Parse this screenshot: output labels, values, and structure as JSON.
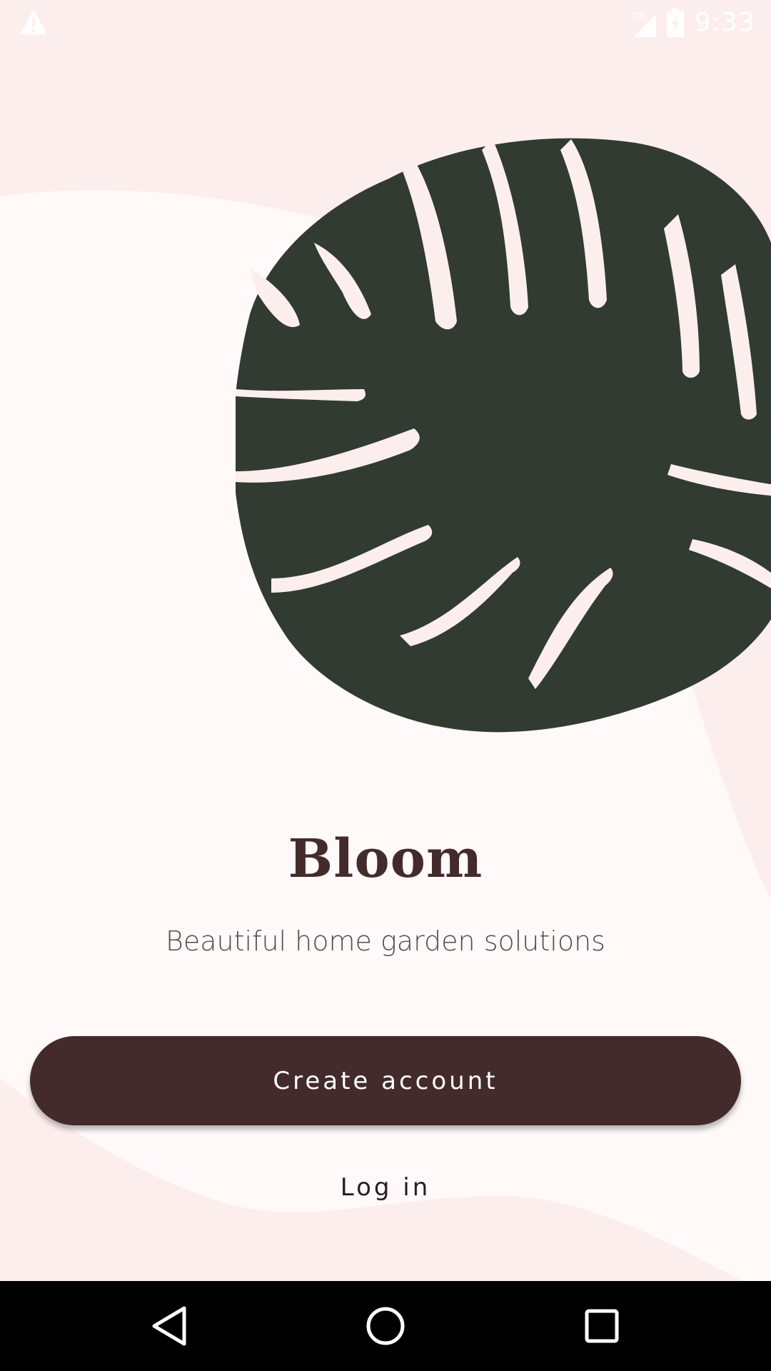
{
  "app": {
    "title": "Bloom",
    "tagline": "Beautiful home garden solutions"
  },
  "actions": {
    "create_account_label": "Create account",
    "login_label": "Log in"
  },
  "status_bar": {
    "time": "9:33",
    "network": "LTE",
    "alert_icon": "warning-icon",
    "signal_icon": "signal-icon",
    "battery_icon": "battery-charging-icon"
  },
  "navigation": {
    "back_icon": "back-triangle-icon",
    "home_icon": "home-circle-icon",
    "recents_icon": "recents-square-icon"
  },
  "illustration": {
    "name": "monstera-leaf"
  },
  "colors": {
    "background": "#fdeeee",
    "surface": "#fff9f9",
    "leaf": "#313b31",
    "primary": "#432b2c",
    "on_primary": "#ffffff",
    "text_secondary": "#4e4e4e",
    "nav_bar": "#000000"
  }
}
